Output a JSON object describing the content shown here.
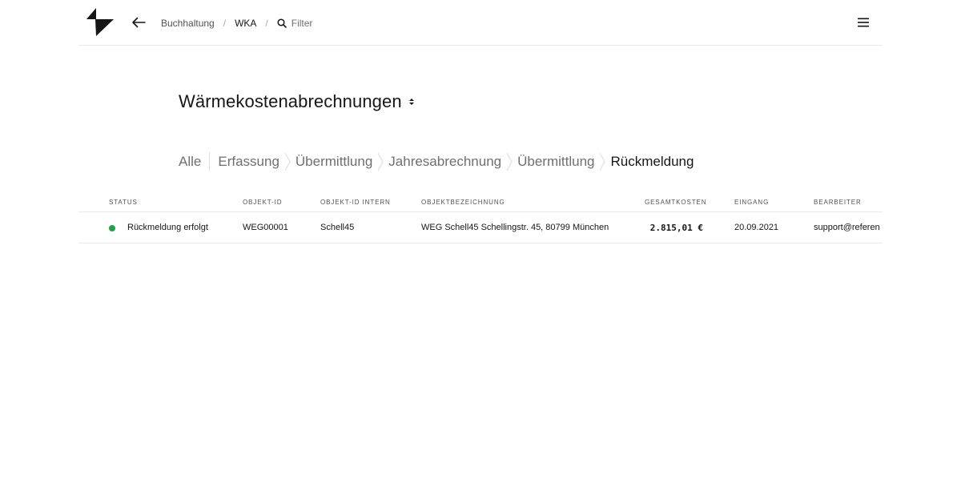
{
  "header": {
    "breadcrumb": [
      {
        "label": "Buchhaltung"
      },
      {
        "label": "WKA"
      }
    ],
    "separator": "/",
    "filter_placeholder": "Filter"
  },
  "title": "Wärmekostenabrechnungen",
  "tabs": [
    {
      "label": "Alle",
      "active": false
    },
    {
      "label": "Erfassung",
      "active": false
    },
    {
      "label": "Übermittlung",
      "active": false
    },
    {
      "label": "Jahresabrechnung",
      "active": false
    },
    {
      "label": "Übermittlung",
      "active": false
    },
    {
      "label": "Rückmeldung",
      "active": true
    }
  ],
  "table": {
    "columns": {
      "status": "Status",
      "objekt_id": "Objekt-ID",
      "objekt_id_intern": "Objekt-ID intern",
      "objektbezeichnung": "Objektbezeichnung",
      "gesamtkosten": "Gesamtkosten",
      "eingang": "Eingang",
      "bearbeiter": "Bearbeiter"
    },
    "rows": [
      {
        "status": "Rückmeldung erfolgt",
        "status_color": "#24a148",
        "objekt_id": "WEG00001",
        "objekt_id_intern": "Schell45",
        "objektbezeichnung": "WEG Schell45 Schellingstr. 45, 80799 München",
        "gesamtkosten": "2.815,01 €",
        "eingang": "20.09.2021",
        "bearbeiter": "support@referen"
      }
    ]
  },
  "icons": {
    "logo": "brand-logo",
    "back": "arrow-left-icon",
    "search": "search-icon",
    "sort": "sort-caret-icon",
    "menu": "hamburger-menu-icon"
  },
  "colors": {
    "text": "#161616",
    "muted": "#6f6f6f",
    "divider": "#e8e8e8",
    "status_success": "#24a148"
  }
}
